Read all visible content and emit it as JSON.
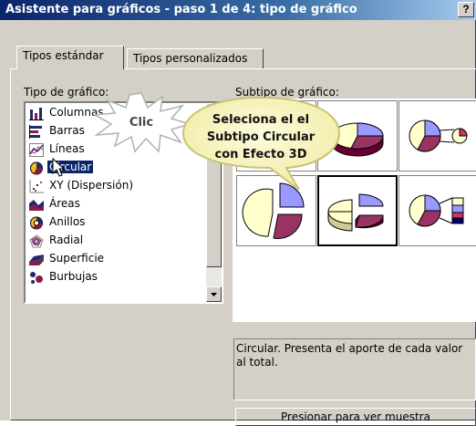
{
  "window": {
    "title": "Asistente para gráficos - paso 1 de 4: tipo de gráfico",
    "help_label": "?"
  },
  "tabs": [
    {
      "label": "Tipos estándar",
      "active": true
    },
    {
      "label": "Tipos personalizados",
      "active": false
    }
  ],
  "chart_type": {
    "label": "Tipo de gráfico:",
    "items": [
      {
        "label": "Columnas",
        "icon": "column-chart-icon"
      },
      {
        "label": "Barras",
        "icon": "bar-chart-icon"
      },
      {
        "label": "Líneas",
        "icon": "line-chart-icon"
      },
      {
        "label": "Circular",
        "icon": "pie-chart-icon",
        "selected": true
      },
      {
        "label": "XY (Dispersión)",
        "icon": "scatter-chart-icon"
      },
      {
        "label": "Áreas",
        "icon": "area-chart-icon"
      },
      {
        "label": "Anillos",
        "icon": "doughnut-chart-icon"
      },
      {
        "label": "Radial",
        "icon": "radar-chart-icon"
      },
      {
        "label": "Superficie",
        "icon": "surface-chart-icon"
      },
      {
        "label": "Burbujas",
        "icon": "bubble-chart-icon"
      }
    ]
  },
  "subtype": {
    "label": "Subtipo de gráfico:"
  },
  "description": "Circular. Presenta el aporte de cada valor al total.",
  "preview_button": "Presionar para ver muestra",
  "annotations": {
    "click_burst": "Clic",
    "callout_lines": [
      "Seleciona el el",
      "Subtipo Circular",
      "con Efecto 3D"
    ]
  }
}
